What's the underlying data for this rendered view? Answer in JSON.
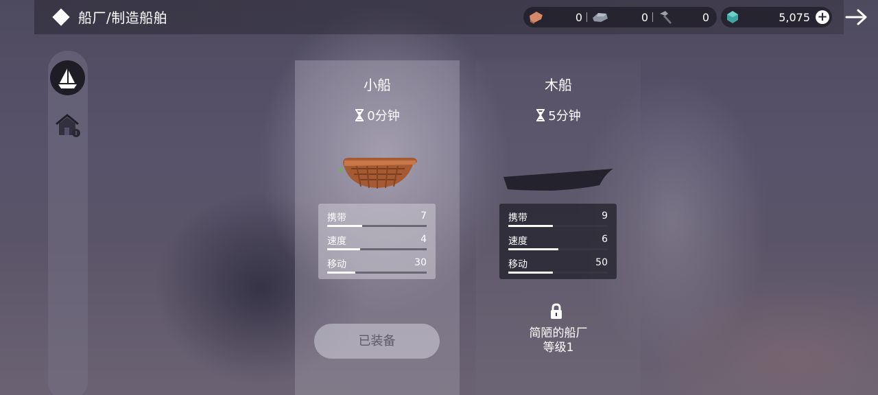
{
  "header": {
    "title": "船厂/制造船舶"
  },
  "resources": {
    "wood": "0",
    "stone": "0",
    "tools": "0",
    "gems": "5,075"
  },
  "boats": [
    {
      "name": "小船",
      "time": "0分钟",
      "stats": [
        {
          "label": "携带",
          "value": "7",
          "level": 0.35
        },
        {
          "label": "速度",
          "value": "4",
          "level": 0.33
        },
        {
          "label": "移动",
          "value": "30",
          "level": 0.28
        }
      ],
      "button": "已装备"
    },
    {
      "name": "木船",
      "time": "5分钟",
      "stats": [
        {
          "label": "携带",
          "value": "9",
          "level": 0.45
        },
        {
          "label": "速度",
          "value": "6",
          "level": 0.5
        },
        {
          "label": "移动",
          "value": "50",
          "level": 0.45
        }
      ],
      "requirement_line1": "简陋的船厂",
      "requirement_line2": "等级1"
    }
  ]
}
